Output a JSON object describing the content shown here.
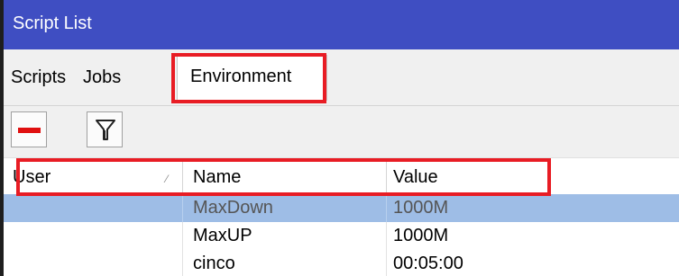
{
  "window": {
    "title": "Script List"
  },
  "tabs": [
    {
      "label": "Scripts"
    },
    {
      "label": "Jobs"
    },
    {
      "label": "Environment",
      "active": true
    }
  ],
  "toolbar": {
    "remove_icon": "minus-icon",
    "filter_icon": "filter-funnel-icon"
  },
  "table": {
    "columns": [
      "User",
      "Name",
      "Value"
    ],
    "sort_icon": "sort-ascending-icon",
    "rows": [
      {
        "user": "",
        "name": "MaxDown",
        "value": "1000M",
        "selected": true
      },
      {
        "user": "",
        "name": "MaxUP",
        "value": "1000M",
        "selected": false
      },
      {
        "user": "",
        "name": "cinco",
        "value": "00:05:00",
        "selected": false
      }
    ]
  },
  "colors": {
    "titlebar": "#3f4ec2",
    "selection": "#9ebde6",
    "highlight": "#e81c24",
    "remove_icon": "#e01010"
  }
}
